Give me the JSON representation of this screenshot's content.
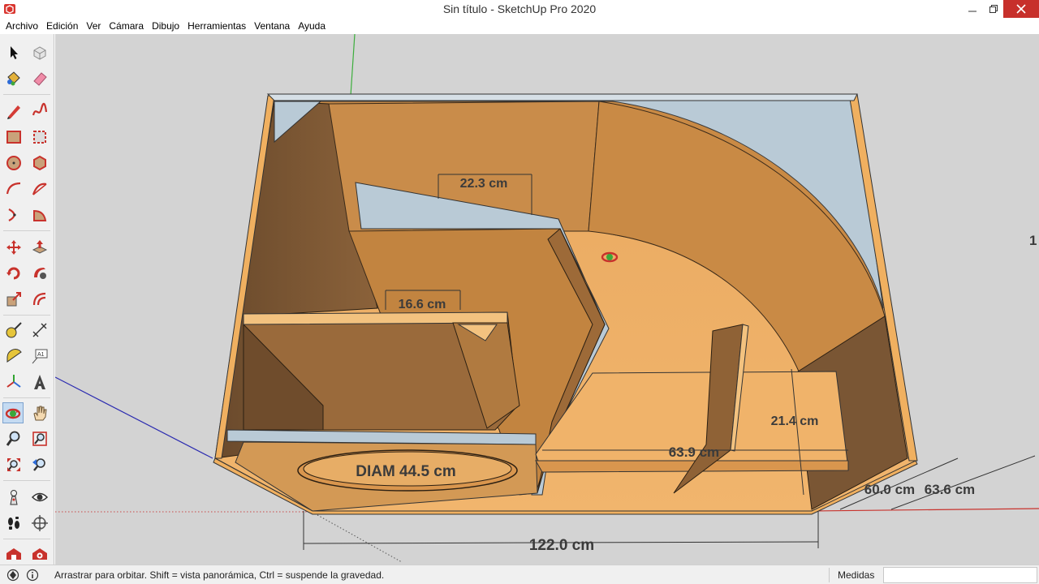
{
  "window": {
    "title": "Sin título - SketchUp Pro 2020",
    "app_icon": "sketchup-logo-icon",
    "controls": [
      "minimize-icon",
      "restore-icon",
      "close-icon"
    ]
  },
  "menu": [
    "Archivo",
    "Edición",
    "Ver",
    "Cámara",
    "Dibujo",
    "Herramientas",
    "Ventana",
    "Ayuda"
  ],
  "toolbar": {
    "tools": [
      {
        "name": "select-tool",
        "icon": "arrow-cursor-icon"
      },
      {
        "name": "make-component-tool",
        "icon": "component-box-icon"
      },
      {
        "name": "paint-bucket-tool",
        "icon": "paint-bucket-icon"
      },
      {
        "name": "eraser-tool",
        "icon": "eraser-icon"
      },
      {
        "name": "line-tool",
        "icon": "pencil-icon"
      },
      {
        "name": "freehand-tool",
        "icon": "freehand-curve-icon"
      },
      {
        "name": "rectangle-tool",
        "icon": "rectangle-icon"
      },
      {
        "name": "rotated-rectangle-tool",
        "icon": "rotated-rectangle-icon"
      },
      {
        "name": "circle-tool",
        "icon": "circle-icon"
      },
      {
        "name": "polygon-tool",
        "icon": "polygon-icon"
      },
      {
        "name": "arc-tool",
        "icon": "arc-icon"
      },
      {
        "name": "two-point-arc-tool",
        "icon": "two-point-arc-icon"
      },
      {
        "name": "three-point-arc-tool",
        "icon": "three-point-arc-icon"
      },
      {
        "name": "pie-tool",
        "icon": "pie-icon"
      },
      {
        "name": "move-tool",
        "icon": "move-arrows-icon"
      },
      {
        "name": "push-pull-tool",
        "icon": "push-pull-icon"
      },
      {
        "name": "rotate-tool",
        "icon": "rotate-icon"
      },
      {
        "name": "follow-me-tool",
        "icon": "follow-me-icon"
      },
      {
        "name": "scale-tool",
        "icon": "scale-icon"
      },
      {
        "name": "offset-tool",
        "icon": "offset-icon"
      },
      {
        "name": "tape-measure-tool",
        "icon": "tape-measure-icon"
      },
      {
        "name": "dimension-tool",
        "icon": "dimension-icon"
      },
      {
        "name": "protractor-tool",
        "icon": "protractor-icon"
      },
      {
        "name": "text-tool",
        "icon": "text-label-icon"
      },
      {
        "name": "axes-tool",
        "icon": "axes-icon"
      },
      {
        "name": "3d-text-tool",
        "icon": "3d-text-icon"
      },
      {
        "name": "orbit-tool",
        "icon": "orbit-icon"
      },
      {
        "name": "pan-tool",
        "icon": "hand-pan-icon"
      },
      {
        "name": "zoom-tool",
        "icon": "magnifier-icon"
      },
      {
        "name": "zoom-window-tool",
        "icon": "zoom-window-icon"
      },
      {
        "name": "zoom-extents-tool",
        "icon": "zoom-extents-icon"
      },
      {
        "name": "previous-view-tool",
        "icon": "previous-view-icon"
      },
      {
        "name": "position-camera-tool",
        "icon": "position-camera-icon"
      },
      {
        "name": "look-around-tool",
        "icon": "eye-icon"
      },
      {
        "name": "walk-tool",
        "icon": "footprints-icon"
      },
      {
        "name": "section-plane-tool",
        "icon": "section-plane-icon"
      },
      {
        "name": "warehouse-tool",
        "icon": "warehouse-icon"
      },
      {
        "name": "extension-warehouse-tool",
        "icon": "extension-warehouse-icon"
      }
    ],
    "active": "orbit-tool"
  },
  "viewport": {
    "dimensions": [
      "22.3 cm",
      "16.6 cm",
      "DIAM 44.5 cm",
      "63.9 cm",
      "21.4 cm",
      "60.0 cm",
      "63.6 cm",
      "122.0 cm"
    ],
    "edge_label": "1"
  },
  "status": {
    "text": "Arrastrar para orbitar. Shift = vista panorámica, Ctrl = suspende la gravedad.",
    "measure_label": "Medidas",
    "measure_value": "",
    "icons": [
      "geo-location-icon",
      "info-icon"
    ]
  }
}
